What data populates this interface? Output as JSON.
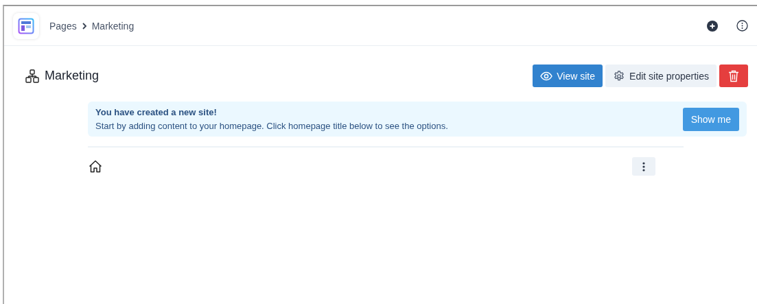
{
  "breadcrumb": [
    "Pages",
    "Marketing"
  ],
  "page": {
    "title": "Marketing"
  },
  "actions": [
    {
      "kind": "view",
      "label": "View site"
    },
    {
      "kind": "edit",
      "label": "Edit site properties"
    },
    {
      "kind": "delete"
    }
  ],
  "banner": {
    "title": "You have created a new site!",
    "text": "Start by adding content to your homepage. Click homepage title below to see the options.",
    "button": "Show me"
  },
  "pages": [
    {
      "kind": "home"
    }
  ]
}
